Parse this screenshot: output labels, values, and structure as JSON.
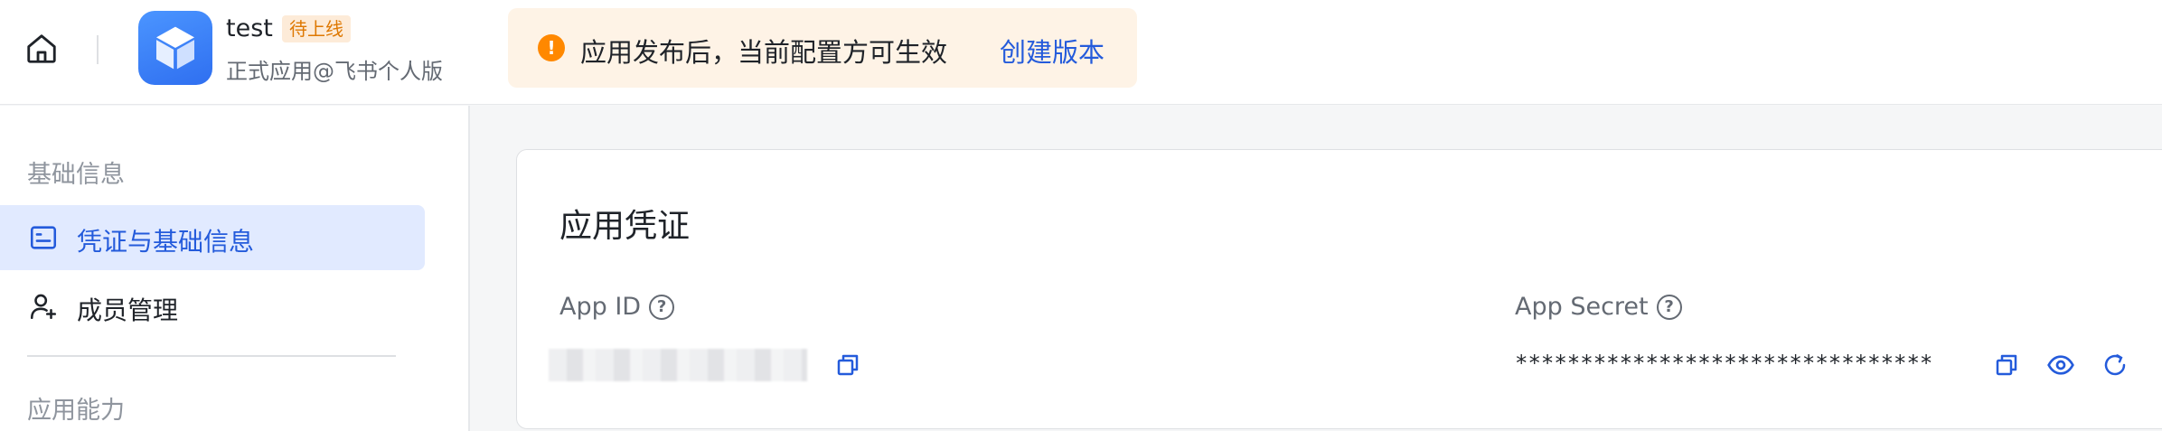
{
  "header": {
    "app_name": "test",
    "app_status_badge": "待上线",
    "app_subtitle": "正式应用@飞书个人版",
    "notice": {
      "text": "应用发布后，当前配置方可生效",
      "link_label": "创建版本",
      "icon": "warning-icon"
    },
    "accent_color": "#245bdb",
    "notice_color": "#ff8800"
  },
  "sidebar": {
    "sections": [
      {
        "title": "基础信息",
        "items": [
          {
            "label": "凭证与基础信息",
            "icon": "credential-icon",
            "active": true
          },
          {
            "label": "成员管理",
            "icon": "add-member-icon",
            "active": false
          }
        ]
      },
      {
        "title": "应用能力",
        "items": []
      }
    ]
  },
  "main": {
    "card_title": "应用凭证",
    "app_id": {
      "label": "App ID",
      "value_masked": true,
      "icons": [
        "help-icon",
        "copy-icon"
      ]
    },
    "app_secret": {
      "label": "App Secret",
      "value": "********************************",
      "icons": [
        "help-icon",
        "copy-icon",
        "eye-icon",
        "refresh-icon"
      ]
    }
  }
}
